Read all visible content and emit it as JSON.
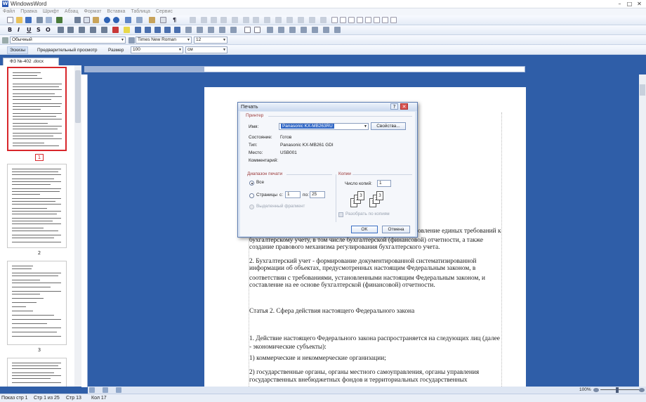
{
  "app": {
    "title": "WindowsWord",
    "icon_letter": "W"
  },
  "menu": [
    "Файл",
    "Правка",
    "Шрифт",
    "Абзац",
    "Формат",
    "Вставка",
    "Таблица",
    "Сервис"
  ],
  "toolbar": {
    "style_value": "Обычный",
    "font_value": "Times New Roman",
    "size_value": "12",
    "bold_label": "B",
    "italic_label": "I",
    "underline_label": "U",
    "strike_label": "S",
    "outline_label": "O",
    "pilcrow": "¶"
  },
  "viewbar": {
    "sketch_label": "Эскизы",
    "preview_label": "Предварительный просмотр",
    "size_label": "Размер",
    "size_value": "100",
    "unit_value": "см"
  },
  "doc_tab": {
    "label": "ФЗ №-402 .docx"
  },
  "thumbnails": [
    {
      "page": "1"
    },
    {
      "page": "2"
    },
    {
      "page": "3"
    }
  ],
  "document": {
    "lines": [
      "бухгалтерскому учету, в том числе бухгалтерской (финансовой) отчетности, а также",
      "создание правового механизма регулирования бухгалтерского учета.",
      "2. Бухгалтерский учет - формирование документированной систематизированной",
      "информации об объектах, предусмотренных настоящим Федеральным законом, в",
      "соответствии с требованиями, установленными настоящим Федеральным законом, и",
      "составление на ее основе бухгалтерской (финансовой) отчетности.",
      "Статья 2. Сфера действия настоящего Федерального закона",
      "1. Действие настоящего Федерального закона распространяется на следующих лиц (далее",
      "- экономические субъекты):",
      "1) коммерческие и некоммерческие организации;",
      "2) государственные органы, органы местного самоуправления, органы управления",
      "государственных внебюджетных фондов и территориальных государственных"
    ],
    "partial_line_right": "овление единых требований к"
  },
  "print_dialog": {
    "title": "Печать",
    "printer_group": "Принтер",
    "name_label": "Имя:",
    "name_value": "Panasonic KX-MB263RU",
    "properties_button": "Свойства...",
    "state_label": "Состояние:",
    "state_value": "Готов",
    "type_label": "Тип:",
    "type_value": "Panasonic KX-MB261 GDI",
    "place_label": "Место:",
    "place_value": "USB001",
    "comment_label": "Комментарий:",
    "range_group": "Диапазон печати",
    "all_label": "Все",
    "pages_label": "Страницы",
    "from_label": "с:",
    "from_value": "1",
    "to_label": "по:",
    "to_value": "25",
    "selection_label": "Выделенный фрагмент",
    "copies_group": "Копии",
    "copies_label": "Число копий:",
    "copies_value": "1",
    "collate_label": "Разобрать по копиям",
    "ok_button": "OK",
    "cancel_button": "Отмена",
    "help_button": "?",
    "close_button": "✕"
  },
  "bottom": {
    "zoom": "100%"
  },
  "status": {
    "page_view": "Показ стр 1",
    "pages": "Стр 1 из 25",
    "line": "Стр 13",
    "col": "Кол 17"
  }
}
